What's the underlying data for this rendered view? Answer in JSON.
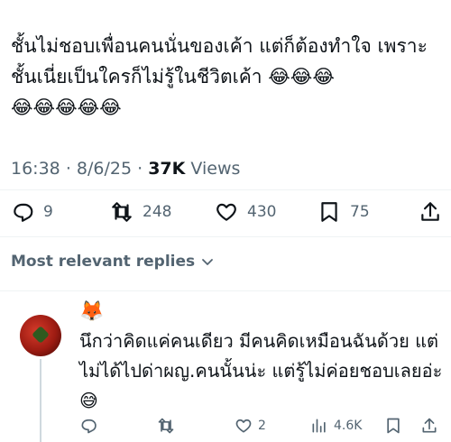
{
  "tweet": {
    "text": "ชั้นไม่ชอบเพื่อนคนนั่นของเค้า แต่ก็ต้องทำใจ เพราะชั้นเนี่ยเป็นใครก็ไม่รู้ในชีวิตเค้า 😂😂😂\n😂😂😂😂😂",
    "time": "16:38",
    "date": "8/6/25",
    "views_count": "37K",
    "views_label": "Views"
  },
  "actions": {
    "replies": "9",
    "retweets": "248",
    "likes": "430",
    "bookmarks": "75"
  },
  "icons": {
    "reply": "reply-icon",
    "retweet": "retweet-icon",
    "like": "heart-icon",
    "bookmark": "bookmark-icon",
    "share": "share-icon",
    "views": "views-icon"
  },
  "replies_header": {
    "label": "Most relevant replies"
  },
  "reply": {
    "display_name": "🦊",
    "text": "นึกว่าคิดแค่คนเดียว มีคนคิดเหมือนฉันด้วย แต่ไม่ได้ไปด่าผญ.คนนั้นน่ะ แต่รู้ไม่ค่อยชอบเลยอ่ะ😅",
    "replies": "",
    "likes": "2",
    "views": "4.6K"
  },
  "colors": {
    "text": "#0f1419",
    "secondary": "#536471",
    "divider": "#eff3f4"
  }
}
